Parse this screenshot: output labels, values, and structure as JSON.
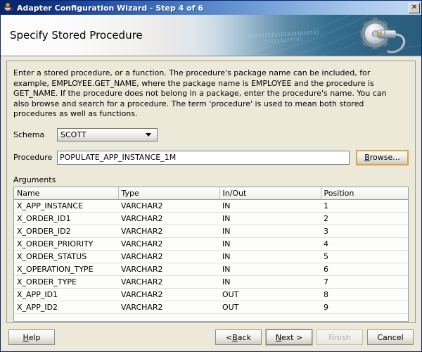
{
  "window": {
    "title": "Adapter Configuration Wizard - Step 4 of 6",
    "icon": "java-coffee-cup-icon",
    "close_label": "✕"
  },
  "banner": {
    "title": "Specify Stored Procedure",
    "binary_text": "0101010101010101010101",
    "binary_text_2": "010101020101"
  },
  "content": {
    "description": "Enter a stored procedure, or a function. The procedure's package name can be included, for example, EMPLOYEE.GET_NAME, where the package name is EMPLOYEE and the procedure is GET_NAME.  If the procedure does not belong in a package, enter the procedure's name. You can also browse and search for a procedure. The term 'procedure' is used to mean both stored procedures as well as functions.",
    "schema": {
      "label": "Schema",
      "value": "SCOTT"
    },
    "procedure": {
      "label": "Procedure",
      "value": "POPULATE_APP_INSTANCE_1M",
      "placeholder": ""
    },
    "browse_button": {
      "prefix": "B",
      "suffix": "rowse..."
    },
    "arguments": {
      "label": "Arguments",
      "columns": [
        "Name",
        "Type",
        "In/Out",
        "Position"
      ],
      "rows": [
        [
          "X_APP_INSTANCE",
          "VARCHAR2",
          "IN",
          "1"
        ],
        [
          "X_ORDER_ID1",
          "VARCHAR2",
          "IN",
          "2"
        ],
        [
          "X_ORDER_ID2",
          "VARCHAR2",
          "IN",
          "3"
        ],
        [
          "X_ORDER_PRIORITY",
          "VARCHAR2",
          "IN",
          "4"
        ],
        [
          "X_ORDER_STATUS",
          "VARCHAR2",
          "IN",
          "5"
        ],
        [
          "X_OPERATION_TYPE",
          "VARCHAR2",
          "IN",
          "6"
        ],
        [
          "X_ORDER_TYPE",
          "VARCHAR2",
          "IN",
          "7"
        ],
        [
          "X_APP_ID1",
          "VARCHAR2",
          "OUT",
          "8"
        ],
        [
          "X_APP_ID2",
          "VARCHAR2",
          "OUT",
          "9"
        ]
      ]
    }
  },
  "buttons": {
    "help": {
      "prefix": "H",
      "suffix": "elp"
    },
    "back": {
      "pre": "< ",
      "prefix": "B",
      "suffix": "ack"
    },
    "next": {
      "prefix": "N",
      "suffix": "ext >"
    },
    "finish": {
      "label": "Finish",
      "enabled": false
    },
    "cancel": {
      "label": "Cancel"
    }
  },
  "colors": {
    "titlebar_start": "#0a246a",
    "titlebar_end": "#c3d9f0",
    "dialog_face": "#ece9d8",
    "banner_right": "#2a5c7d",
    "focus_ring": "#d9a441"
  }
}
